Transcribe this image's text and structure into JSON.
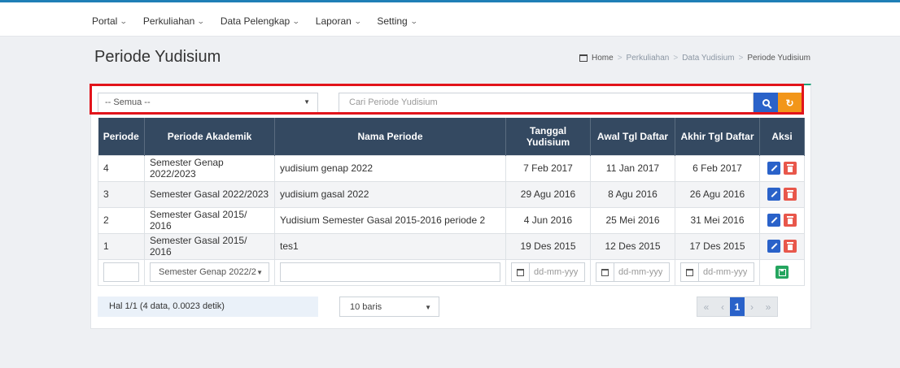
{
  "nav": {
    "items": [
      {
        "label": "Portal"
      },
      {
        "label": "Perkuliahan"
      },
      {
        "label": "Data Pelengkap"
      },
      {
        "label": "Laporan"
      },
      {
        "label": "Setting"
      }
    ]
  },
  "page": {
    "title": "Periode Yudisium"
  },
  "breadcrumb": {
    "items": [
      "Home",
      "Perkuliahan",
      "Data Yudisium",
      "Periode Yudisium"
    ]
  },
  "filter": {
    "select_value": "-- Semua --",
    "search_placeholder": "Cari Periode Yudisium"
  },
  "table": {
    "headers": [
      "Periode",
      "Periode Akademik",
      "Nama Periode",
      "Tanggal Yudisium",
      "Awal Tgl Daftar",
      "Akhir Tgl Daftar",
      "Aksi"
    ],
    "rows": [
      {
        "periode": "4",
        "akademik": "Semester Genap 2022/2023",
        "nama": "yudisium genap 2022",
        "tanggal": "7 Feb 2017",
        "awal": "11 Jan 2017",
        "akhir": "6 Feb 2017"
      },
      {
        "periode": "3",
        "akademik": "Semester Gasal 2022/2023",
        "nama": "yudisium gasal 2022",
        "tanggal": "29 Agu 2016",
        "awal": "8 Agu 2016",
        "akhir": "26 Agu 2016"
      },
      {
        "periode": "2",
        "akademik": "Semester Gasal 2015/ 2016",
        "nama": "Yudisium Semester Gasal 2015-2016 periode 2",
        "tanggal": "4 Jun 2016",
        "awal": "25 Mei 2016",
        "akhir": "31 Mei 2016"
      },
      {
        "periode": "1",
        "akademik": "Semester Gasal 2015/ 2016",
        "nama": "tes1",
        "tanggal": "19 Des 2015",
        "awal": "12 Des 2015",
        "akhir": "17 Des 2015"
      }
    ],
    "new_row": {
      "periode_value": "",
      "akademik_value": "Semester Genap 2022/2",
      "nama_value": "",
      "date_placeholder": "dd-mm-yyy"
    }
  },
  "footer": {
    "info": "Hal 1/1 (4 data, 0.0023 detik)",
    "rows_value": "10 baris",
    "pager": {
      "first": "«",
      "prev": "‹",
      "current": "1",
      "next": "›",
      "last": "»"
    }
  },
  "colors": {
    "accent": "#2a62c9",
    "header_bg": "#344961",
    "refresh": "#f2961a",
    "delete": "#e8574b",
    "save": "#25a55f",
    "highlight_box": "#e2141b"
  }
}
